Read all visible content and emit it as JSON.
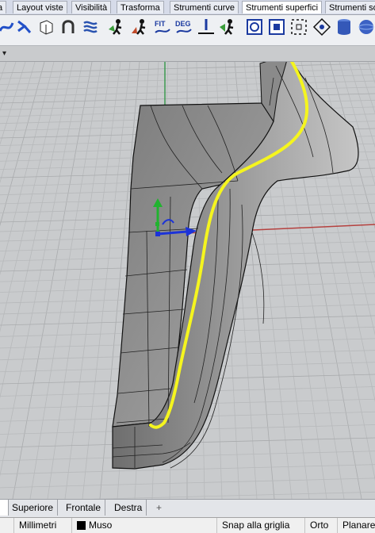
{
  "tabs": [
    {
      "label": "a",
      "active": false
    },
    {
      "label": "Layout viste",
      "active": false
    },
    {
      "label": "Visibilità",
      "active": false
    },
    {
      "label": "Trasforma",
      "active": false
    },
    {
      "label": "Strumenti curve",
      "active": false
    },
    {
      "label": "Strumenti superfici",
      "active": true
    },
    {
      "label": "Strumenti so",
      "active": false
    }
  ],
  "toolbar": {
    "fit_label": "FIT",
    "deg_label": "DEG",
    "icons": [
      "blend-curve-icon",
      "match-curve-icon",
      "extrude-surface-icon",
      "arch-surface-icon",
      "network-surface-icon",
      "analyze-person-icon",
      "analyze-person-alt-icon",
      "fit-tolerance-icon",
      "degree-icon",
      "flat-surface-icon",
      "analyze-surface-icon",
      "rebuild-grid-icon",
      "edit-points-icon",
      "control-points-icon",
      "point-gumball-icon",
      "cylinder-icon",
      "sphere-icon"
    ]
  },
  "viewport": {
    "menu_glyph": "▾",
    "colors": {
      "background": "#c9cbcd",
      "grid_minor": "#b7b9bb",
      "grid_major": "#a9abad",
      "x_axis": "#b5413f",
      "y_axis": "#3c9a50",
      "surface": "#8f8f8f",
      "surface_light": "#b9b9b9",
      "edge_curve": "#f5f51e",
      "gumball_x": "#1c33d8",
      "gumball_y": "#21b32f"
    }
  },
  "viewport_tabs": [
    {
      "label": "Superiore"
    },
    {
      "label": "Frontale"
    },
    {
      "label": "Destra"
    },
    {
      "label": "+"
    }
  ],
  "statusbar": {
    "units": "Millimetri",
    "layer": "Muso",
    "snap": "Snap alla griglia",
    "ortho": "Orto",
    "planar": "Planare"
  }
}
